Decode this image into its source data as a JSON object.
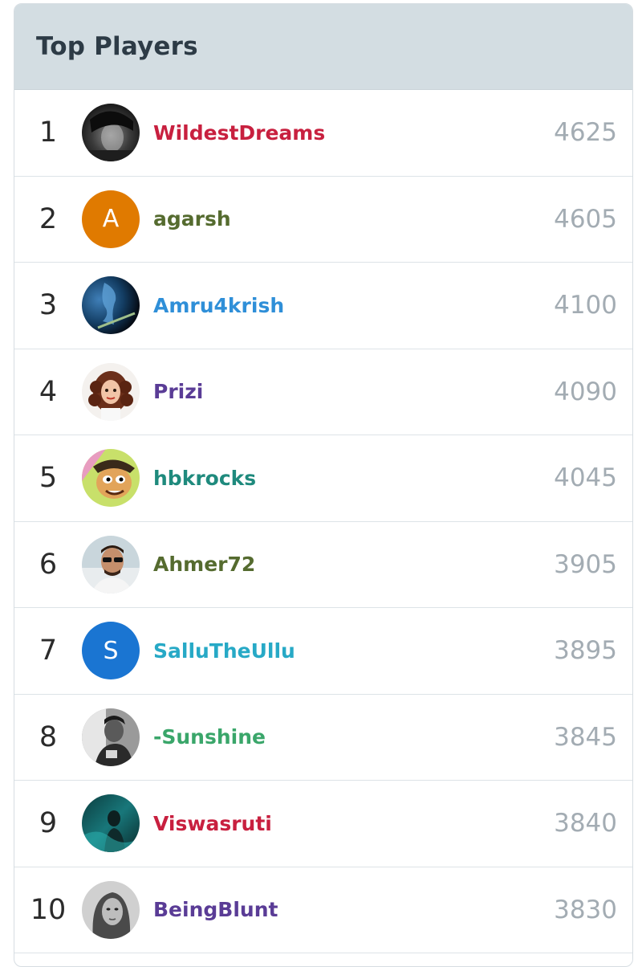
{
  "header": {
    "title": "Top Players"
  },
  "players": [
    {
      "rank": "1",
      "name": "WildestDreams",
      "score": "4625",
      "name_color": "#c8203f",
      "avatar": {
        "kind": "photo",
        "icon": "dark-portrait-photo"
      }
    },
    {
      "rank": "2",
      "name": "agarsh",
      "score": "4605",
      "name_color": "#556b2f",
      "avatar": {
        "kind": "letter",
        "letter": "A",
        "bg": "#e07a00"
      }
    },
    {
      "rank": "3",
      "name": "Amru4krish",
      "score": "4100",
      "name_color": "#2f8fd8",
      "avatar": {
        "kind": "photo",
        "icon": "blue-face-photo"
      }
    },
    {
      "rank": "4",
      "name": "Prizi",
      "score": "4090",
      "name_color": "#5a3c96",
      "avatar": {
        "kind": "photo",
        "icon": "curly-hair-cartoon"
      }
    },
    {
      "rank": "5",
      "name": "hbkrocks",
      "score": "4045",
      "name_color": "#1f8a7d",
      "avatar": {
        "kind": "photo",
        "icon": "cartoon-character"
      }
    },
    {
      "rank": "6",
      "name": "Ahmer72",
      "score": "3905",
      "name_color": "#556b2f",
      "avatar": {
        "kind": "photo",
        "icon": "man-sunglasses-photo"
      }
    },
    {
      "rank": "7",
      "name": "SalluTheUllu",
      "score": "3895",
      "name_color": "#27a9c6",
      "avatar": {
        "kind": "letter",
        "letter": "S",
        "bg": "#1a75d2"
      }
    },
    {
      "rank": "8",
      "name": "-Sunshine",
      "score": "3845",
      "name_color": "#3aa66a",
      "avatar": {
        "kind": "photo",
        "icon": "grayscale-person-photo"
      }
    },
    {
      "rank": "9",
      "name": "Viswasruti",
      "score": "3840",
      "name_color": "#c8203f",
      "avatar": {
        "kind": "photo",
        "icon": "teal-scene-photo"
      }
    },
    {
      "rank": "10",
      "name": "BeingBlunt",
      "score": "3830",
      "name_color": "#5a3c96",
      "avatar": {
        "kind": "photo",
        "icon": "grayscale-woman-photo"
      }
    }
  ]
}
